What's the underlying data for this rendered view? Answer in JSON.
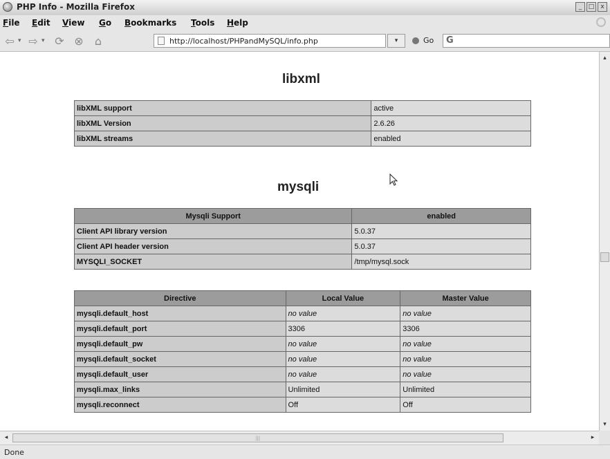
{
  "window": {
    "title": "PHP Info - Mozilla Firefox",
    "controls": [
      "_",
      "□",
      "x"
    ]
  },
  "menu": [
    {
      "label": "File",
      "key": "F"
    },
    {
      "label": "Edit",
      "key": "E"
    },
    {
      "label": "View",
      "key": "V"
    },
    {
      "label": "Go",
      "key": "G"
    },
    {
      "label": "Bookmarks",
      "key": "B"
    },
    {
      "label": "Tools",
      "key": "T"
    },
    {
      "label": "Help",
      "key": "H"
    }
  ],
  "nav": {
    "url": "http://localhost/PHPandMySQL/info.php",
    "go_label": "Go",
    "search_prefix": "G"
  },
  "libxml": {
    "heading": "libxml",
    "rows": [
      {
        "label": "libXML support",
        "value": "active"
      },
      {
        "label": "libXML Version",
        "value": "2.6.26"
      },
      {
        "label": "libXML streams",
        "value": "enabled"
      }
    ]
  },
  "mysqli": {
    "heading": "mysqli",
    "header": [
      "Mysqli Support",
      "enabled"
    ],
    "rows": [
      {
        "label": "Client API library version",
        "value": "5.0.37"
      },
      {
        "label": "Client API header version",
        "value": "5.0.37"
      },
      {
        "label": "MYSQLI_SOCKET",
        "value": "/tmp/mysql.sock"
      }
    ],
    "directive_header": [
      "Directive",
      "Local Value",
      "Master Value"
    ],
    "directives": [
      {
        "name": "mysqli.default_host",
        "local": "no value",
        "master": "no value"
      },
      {
        "name": "mysqli.default_port",
        "local": "3306",
        "master": "3306"
      },
      {
        "name": "mysqli.default_pw",
        "local": "no value",
        "master": "no value"
      },
      {
        "name": "mysqli.default_socket",
        "local": "no value",
        "master": "no value"
      },
      {
        "name": "mysqli.default_user",
        "local": "no value",
        "master": "no value"
      },
      {
        "name": "mysqli.max_links",
        "local": "Unlimited",
        "master": "Unlimited"
      },
      {
        "name": "mysqli.reconnect",
        "local": "Off",
        "master": "Off"
      }
    ]
  },
  "status": {
    "text": "Done"
  }
}
